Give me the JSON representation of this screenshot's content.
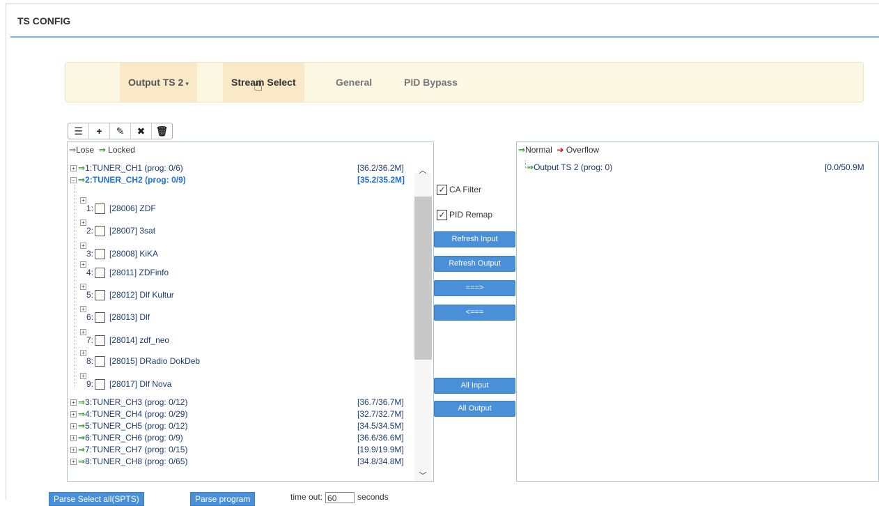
{
  "page": {
    "title": "TS CONFIG"
  },
  "nav": {
    "output_ts": "Output TS 2",
    "tabs": [
      "Stream Select",
      "General",
      "PID Bypass"
    ]
  },
  "toolbar": {
    "icons": [
      "list-icon",
      "plus-icon",
      "pencil-icon",
      "close-icon",
      "trash-icon"
    ]
  },
  "input_panel": {
    "legend": {
      "lose": "Lose",
      "locked": "Locked"
    },
    "tuners": [
      {
        "label": "1:TUNER_CH1 (prog: 0/6)",
        "rate": "[36.2/36.2M]"
      },
      {
        "label": "2:TUNER_CH2 (prog: 0/9)",
        "rate": "[35.2/35.2M]"
      },
      {
        "label": "3:TUNER_CH3 (prog: 0/12)",
        "rate": "[36.7/36.7M]"
      },
      {
        "label": "4:TUNER_CH4 (prog: 0/29)",
        "rate": "[32.7/32.7M]"
      },
      {
        "label": "5:TUNER_CH5 (prog: 0/12)",
        "rate": "[34.5/34.5M]"
      },
      {
        "label": "6:TUNER_CH6 (prog: 0/9)",
        "rate": "[36.6/36.6M]"
      },
      {
        "label": "7:TUNER_CH7 (prog: 0/15)",
        "rate": "[19.9/19.9M]"
      },
      {
        "label": "8:TUNER_CH8 (prog: 0/65)",
        "rate": "[34.8/34.8M]"
      }
    ],
    "programs": [
      {
        "num": "1:",
        "label": "[28006] ZDF"
      },
      {
        "num": "2:",
        "label": "[28007] 3sat"
      },
      {
        "num": "3:",
        "label": "[28008] KiKA"
      },
      {
        "num": "4:",
        "label": "[28011] ZDFinfo"
      },
      {
        "num": "5:",
        "label": "[28012] Dlf Kultur"
      },
      {
        "num": "6:",
        "label": "[28013] Dlf"
      },
      {
        "num": "7:",
        "label": "[28014] zdf_neo"
      },
      {
        "num": "8:",
        "label": "[28015] DRadio DokDeb"
      },
      {
        "num": "9:",
        "label": "[28017] Dlf Nova"
      }
    ]
  },
  "middle": {
    "ca_filter": "CA Filter",
    "pid_remap": "PID Remap",
    "refresh_input": "Refresh Input",
    "refresh_output": "Refresh Output",
    "move_right": "===>",
    "move_left": "<===",
    "all_input": "All Input",
    "all_output": "All Output"
  },
  "output_panel": {
    "legend": {
      "normal": "Normal",
      "overflow": "Overflow"
    },
    "items": [
      {
        "label": "Output TS 2 (prog: 0)",
        "rate": "[0.0/50.9M"
      }
    ]
  },
  "bottom": {
    "parse_select_all": "Parse Select all(SPTS)",
    "parse_program": "Parse program",
    "timeout_label": "time out:",
    "timeout_value": "60",
    "timeout_unit": "seconds"
  },
  "colors": {
    "accent_blue": "#4a90d9",
    "header_rule": "#7bb7d0",
    "nav_bg": "#fcf8e3",
    "locked_arrow": "#2e9e2e",
    "overflow_arrow": "#dd0000"
  }
}
